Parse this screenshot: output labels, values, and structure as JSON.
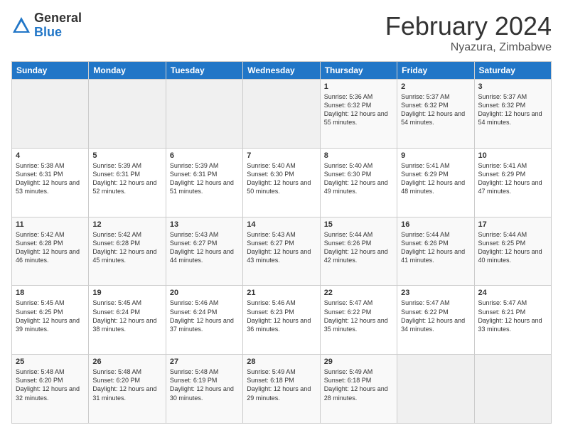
{
  "logo": {
    "general": "General",
    "blue": "Blue"
  },
  "header": {
    "title": "February 2024",
    "subtitle": "Nyazura, Zimbabwe"
  },
  "calendar": {
    "days_of_week": [
      "Sunday",
      "Monday",
      "Tuesday",
      "Wednesday",
      "Thursday",
      "Friday",
      "Saturday"
    ],
    "weeks": [
      [
        {
          "day": "",
          "info": ""
        },
        {
          "day": "",
          "info": ""
        },
        {
          "day": "",
          "info": ""
        },
        {
          "day": "",
          "info": ""
        },
        {
          "day": "1",
          "info": "Sunrise: 5:36 AM\nSunset: 6:32 PM\nDaylight: 12 hours and 55 minutes."
        },
        {
          "day": "2",
          "info": "Sunrise: 5:37 AM\nSunset: 6:32 PM\nDaylight: 12 hours and 54 minutes."
        },
        {
          "day": "3",
          "info": "Sunrise: 5:37 AM\nSunset: 6:32 PM\nDaylight: 12 hours and 54 minutes."
        }
      ],
      [
        {
          "day": "4",
          "info": "Sunrise: 5:38 AM\nSunset: 6:31 PM\nDaylight: 12 hours and 53 minutes."
        },
        {
          "day": "5",
          "info": "Sunrise: 5:39 AM\nSunset: 6:31 PM\nDaylight: 12 hours and 52 minutes."
        },
        {
          "day": "6",
          "info": "Sunrise: 5:39 AM\nSunset: 6:31 PM\nDaylight: 12 hours and 51 minutes."
        },
        {
          "day": "7",
          "info": "Sunrise: 5:40 AM\nSunset: 6:30 PM\nDaylight: 12 hours and 50 minutes."
        },
        {
          "day": "8",
          "info": "Sunrise: 5:40 AM\nSunset: 6:30 PM\nDaylight: 12 hours and 49 minutes."
        },
        {
          "day": "9",
          "info": "Sunrise: 5:41 AM\nSunset: 6:29 PM\nDaylight: 12 hours and 48 minutes."
        },
        {
          "day": "10",
          "info": "Sunrise: 5:41 AM\nSunset: 6:29 PM\nDaylight: 12 hours and 47 minutes."
        }
      ],
      [
        {
          "day": "11",
          "info": "Sunrise: 5:42 AM\nSunset: 6:28 PM\nDaylight: 12 hours and 46 minutes."
        },
        {
          "day": "12",
          "info": "Sunrise: 5:42 AM\nSunset: 6:28 PM\nDaylight: 12 hours and 45 minutes."
        },
        {
          "day": "13",
          "info": "Sunrise: 5:43 AM\nSunset: 6:27 PM\nDaylight: 12 hours and 44 minutes."
        },
        {
          "day": "14",
          "info": "Sunrise: 5:43 AM\nSunset: 6:27 PM\nDaylight: 12 hours and 43 minutes."
        },
        {
          "day": "15",
          "info": "Sunrise: 5:44 AM\nSunset: 6:26 PM\nDaylight: 12 hours and 42 minutes."
        },
        {
          "day": "16",
          "info": "Sunrise: 5:44 AM\nSunset: 6:26 PM\nDaylight: 12 hours and 41 minutes."
        },
        {
          "day": "17",
          "info": "Sunrise: 5:44 AM\nSunset: 6:25 PM\nDaylight: 12 hours and 40 minutes."
        }
      ],
      [
        {
          "day": "18",
          "info": "Sunrise: 5:45 AM\nSunset: 6:25 PM\nDaylight: 12 hours and 39 minutes."
        },
        {
          "day": "19",
          "info": "Sunrise: 5:45 AM\nSunset: 6:24 PM\nDaylight: 12 hours and 38 minutes."
        },
        {
          "day": "20",
          "info": "Sunrise: 5:46 AM\nSunset: 6:24 PM\nDaylight: 12 hours and 37 minutes."
        },
        {
          "day": "21",
          "info": "Sunrise: 5:46 AM\nSunset: 6:23 PM\nDaylight: 12 hours and 36 minutes."
        },
        {
          "day": "22",
          "info": "Sunrise: 5:47 AM\nSunset: 6:22 PM\nDaylight: 12 hours and 35 minutes."
        },
        {
          "day": "23",
          "info": "Sunrise: 5:47 AM\nSunset: 6:22 PM\nDaylight: 12 hours and 34 minutes."
        },
        {
          "day": "24",
          "info": "Sunrise: 5:47 AM\nSunset: 6:21 PM\nDaylight: 12 hours and 33 minutes."
        }
      ],
      [
        {
          "day": "25",
          "info": "Sunrise: 5:48 AM\nSunset: 6:20 PM\nDaylight: 12 hours and 32 minutes."
        },
        {
          "day": "26",
          "info": "Sunrise: 5:48 AM\nSunset: 6:20 PM\nDaylight: 12 hours and 31 minutes."
        },
        {
          "day": "27",
          "info": "Sunrise: 5:48 AM\nSunset: 6:19 PM\nDaylight: 12 hours and 30 minutes."
        },
        {
          "day": "28",
          "info": "Sunrise: 5:49 AM\nSunset: 6:18 PM\nDaylight: 12 hours and 29 minutes."
        },
        {
          "day": "29",
          "info": "Sunrise: 5:49 AM\nSunset: 6:18 PM\nDaylight: 12 hours and 28 minutes."
        },
        {
          "day": "",
          "info": ""
        },
        {
          "day": "",
          "info": ""
        }
      ]
    ]
  }
}
